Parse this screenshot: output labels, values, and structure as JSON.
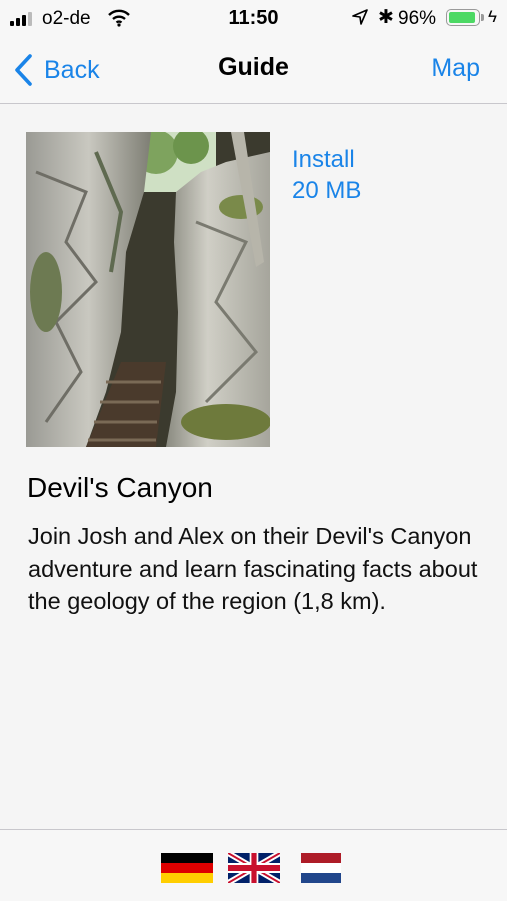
{
  "status_bar": {
    "carrier": "o2-de",
    "time": "11:50",
    "battery_percent": "96%",
    "battery_level": 0.96,
    "icons": [
      "signal-icon",
      "wifi-icon",
      "location-arrow-icon",
      "bluetooth-icon",
      "battery-icon",
      "charging-bolt-icon"
    ]
  },
  "nav": {
    "back_label": "Back",
    "title": "Guide",
    "map_label": "Map"
  },
  "guide": {
    "install_label": "Install",
    "size": "20 MB",
    "title": "Devil's Canyon",
    "description": "Join Josh and Alex on their Devil's Canyon adventure and learn fascinating facts about the geology of the region (1,8 km)."
  },
  "languages": [
    "german-flag",
    "uk-flag",
    "dutch-flag"
  ],
  "colors": {
    "accent": "#1a84e8",
    "battery": "#4cd964",
    "background": "#f5f5f5"
  }
}
